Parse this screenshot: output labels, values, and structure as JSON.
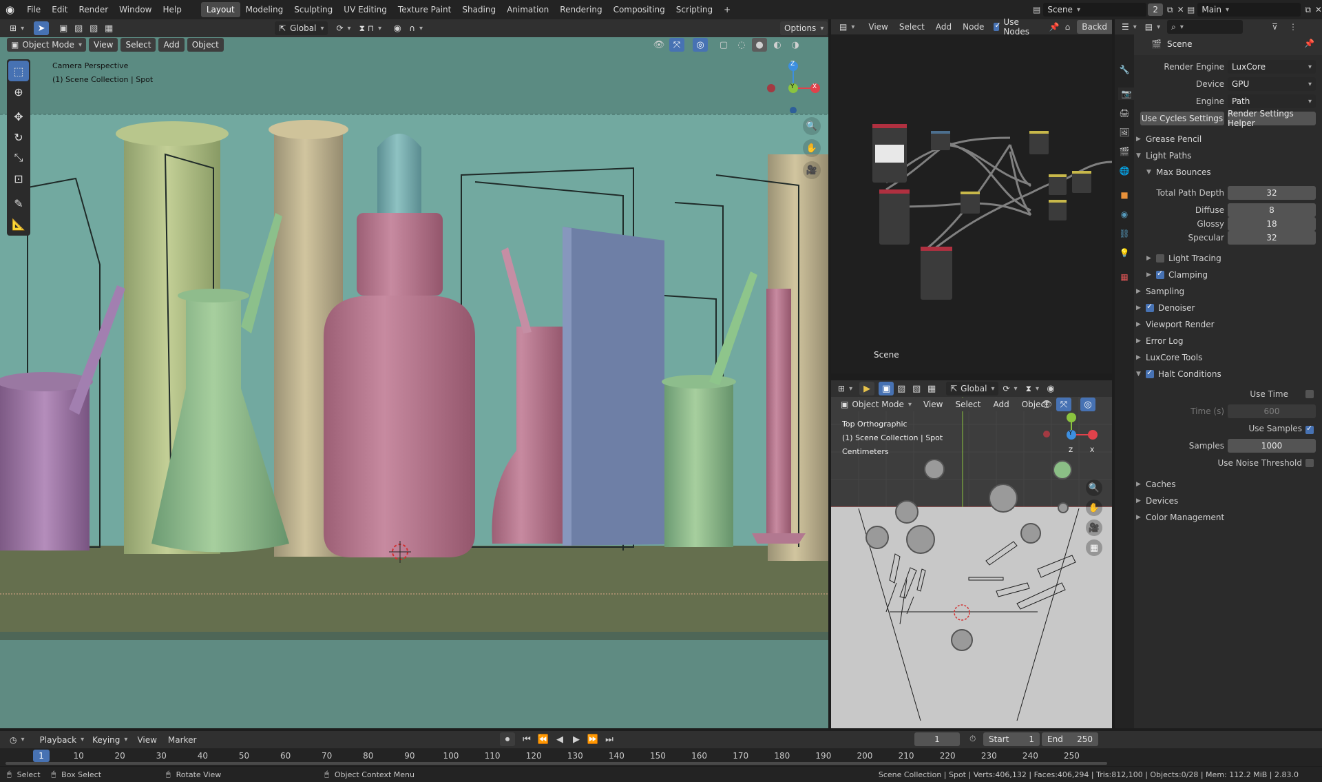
{
  "topbar": {
    "menus": [
      "File",
      "Edit",
      "Render",
      "Window",
      "Help"
    ],
    "workspaces": [
      "Layout",
      "Modeling",
      "Sculpting",
      "UV Editing",
      "Texture Paint",
      "Shading",
      "Animation",
      "Rendering",
      "Compositing",
      "Scripting"
    ],
    "active_workspace": "Layout",
    "add_tab": "+",
    "scene_name": "Scene",
    "scene_users": "2",
    "view_layer": "Main"
  },
  "viewport": {
    "mode": "Object Mode",
    "menus": [
      "View",
      "Select",
      "Add",
      "Object"
    ],
    "transform": "Global",
    "options": "Options",
    "overlay_line1": "Camera Perspective",
    "overlay_line2": "(1) Scene Collection | Spot",
    "gizmo": {
      "x": "X",
      "y": "Y",
      "z": "Z"
    }
  },
  "node_editor": {
    "menus": [
      "View",
      "Select",
      "Add",
      "Node"
    ],
    "use_nodes_label": "Use Nodes",
    "use_nodes": true,
    "backdrop": "Backd",
    "label": "Scene"
  },
  "top_view": {
    "transform": "Global",
    "mode": "Object Mode",
    "menus": [
      "View",
      "Select",
      "Add",
      "Object"
    ],
    "overlay_line1": "Top Orthographic",
    "overlay_line2": "(1) Scene Collection | Spot",
    "overlay_line3": "Centimeters",
    "gizmo": {
      "x": "X",
      "y": "Y",
      "z": "Z"
    }
  },
  "properties": {
    "title": "Scene",
    "render_engine_label": "Render Engine",
    "render_engine": "LuxCore",
    "device_label": "Device",
    "device": "GPU",
    "engine_label": "Engine",
    "engine": "Path",
    "use_cycles_btn": "Use Cycles Settings",
    "helper_btn": "Render Settings Helper",
    "sections": {
      "grease_pencil": "Grease Pencil",
      "light_paths": "Light Paths",
      "max_bounces": "Max Bounces",
      "light_tracing": "Light Tracing",
      "clamping": "Clamping",
      "sampling": "Sampling",
      "denoiser": "Denoiser",
      "viewport_render": "Viewport Render",
      "error_log": "Error Log",
      "luxcore_tools": "LuxCore Tools",
      "halt_conditions": "Halt Conditions",
      "caches": "Caches",
      "devices": "Devices",
      "color_management": "Color Management"
    },
    "checks": {
      "light_tracing": false,
      "clamping": true,
      "denoiser": true,
      "halt_conditions": true,
      "use_time": false,
      "use_samples": true,
      "use_noise_threshold": false
    },
    "bounces": {
      "total_label": "Total Path Depth",
      "total": "32",
      "diffuse_label": "Diffuse",
      "diffuse": "8",
      "glossy_label": "Glossy",
      "glossy": "18",
      "specular_label": "Specular",
      "specular": "32"
    },
    "halt": {
      "use_time_label": "Use Time",
      "time_label": "Time (s)",
      "time": "600",
      "use_samples_label": "Use Samples",
      "samples_label": "Samples",
      "samples": "1000",
      "noise_label": "Use Noise Threshold"
    }
  },
  "timeline": {
    "menus": [
      "Playback",
      "Keying",
      "View",
      "Marker"
    ],
    "current_frame": "1",
    "start_label": "Start",
    "start": "1",
    "end_label": "End",
    "end": "250",
    "ticks": [
      "1",
      "10",
      "20",
      "30",
      "40",
      "50",
      "60",
      "70",
      "80",
      "90",
      "100",
      "110",
      "120",
      "130",
      "140",
      "150",
      "160",
      "170",
      "180",
      "190",
      "200",
      "210",
      "220",
      "230",
      "240",
      "250"
    ]
  },
  "statusbar": {
    "select": "Select",
    "box_select": "Box Select",
    "rotate": "Rotate View",
    "context": "Object Context Menu",
    "stats": "Scene Collection | Spot | Verts:406,132 | Faces:406,294 | Tris:812,100 | Objects:0/28 | Mem: 112.2 MiB | 2.83.0"
  },
  "colors": {
    "accent": "#4772b3",
    "header": "#303030",
    "panel": "#2b2b2b",
    "viewport_bg": "#5f8f87",
    "xaxis": "#e0424b",
    "yaxis": "#8bc43f",
    "zaxis": "#3d8fe0"
  }
}
